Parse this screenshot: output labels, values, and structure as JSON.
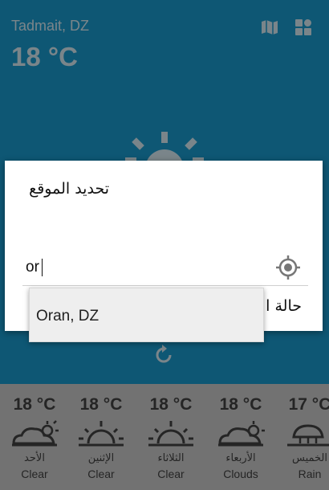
{
  "header": {
    "location": "Tadmait, DZ",
    "temperature": "18 °C",
    "map_icon": "map-icon",
    "menu_icon": "grid-icon"
  },
  "main": {
    "weather_icon": "sun-icon",
    "refresh_icon": "refresh-icon"
  },
  "forecast": [
    {
      "temp": "18 °C",
      "day": "الأحد",
      "condition": "Clear",
      "icon": "cloud-sun-icon"
    },
    {
      "temp": "18 °C",
      "day": "الإثنين",
      "condition": "Clear",
      "icon": "sunrise-icon"
    },
    {
      "temp": "18 °C",
      "day": "الثلاثاء",
      "condition": "Clear",
      "icon": "sunrise-icon"
    },
    {
      "temp": "18 °C",
      "day": "الأربعاء",
      "condition": "Clouds",
      "icon": "cloud-sun-icon"
    },
    {
      "temp": "17 °C",
      "day": "الخميس",
      "condition": "Rain",
      "icon": "rain-icon"
    }
  ],
  "dialog": {
    "title": "تحديد الموقع",
    "input_value": "or",
    "gps_icon": "gps-icon",
    "partial_label": "حالة ا"
  },
  "dropdown": {
    "suggestion": "Oran, DZ"
  },
  "colors": {
    "accent": "#1a9ed3",
    "forecast_bg": "#cfcfcf"
  }
}
